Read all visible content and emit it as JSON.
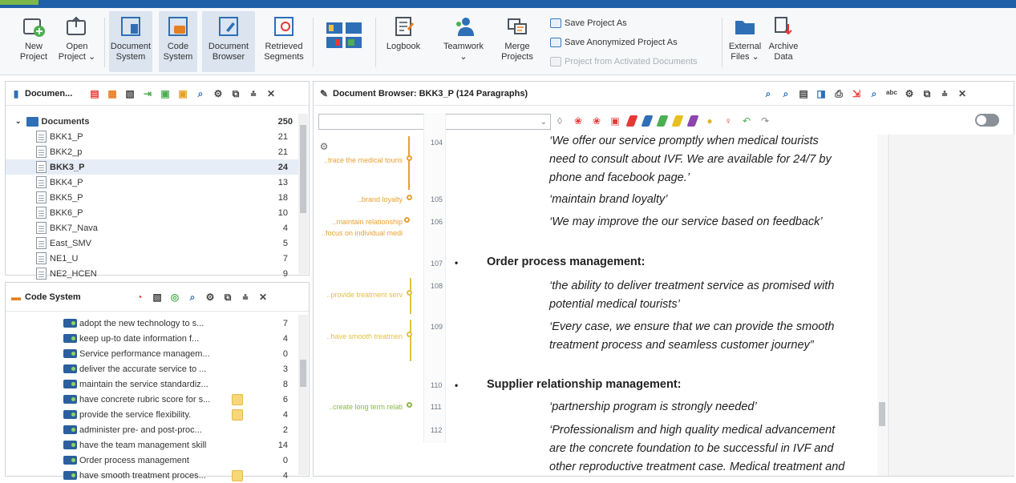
{
  "ribbon": {
    "buttons": [
      {
        "label": "New\nProject"
      },
      {
        "label": "Open\nProject ⌄"
      },
      {
        "label": "Document\nSystem"
      },
      {
        "label": "Code\nSystem"
      },
      {
        "label": "Document\nBrowser"
      },
      {
        "label": "Retrieved\nSegments"
      },
      {
        "label": "Logbook"
      },
      {
        "label": "Teamwork\n⌄"
      },
      {
        "label": "Merge\nProjects"
      },
      {
        "label": "External\nFiles ⌄"
      },
      {
        "label": "Archive\nData"
      }
    ],
    "small_actions": [
      {
        "label": "Save Project As"
      },
      {
        "label": "Save Anonymized Project As"
      },
      {
        "label": "Project from Activated Documents"
      }
    ]
  },
  "documents_panel": {
    "title": "Documen...",
    "root": {
      "label": "Documents",
      "count": "250"
    },
    "items": [
      {
        "label": "BKK1_P",
        "count": "21"
      },
      {
        "label": "BKK2_p",
        "count": "21"
      },
      {
        "label": "BKK3_P",
        "count": "24"
      },
      {
        "label": "BKK4_P",
        "count": "13"
      },
      {
        "label": "BKK5_P",
        "count": "18"
      },
      {
        "label": "BKK6_P",
        "count": "10"
      },
      {
        "label": "BKK7_Nava",
        "count": "4"
      },
      {
        "label": "East_SMV",
        "count": "5"
      },
      {
        "label": "NE1_U",
        "count": "7"
      },
      {
        "label": "NE2_HCEN",
        "count": "9"
      }
    ]
  },
  "code_panel": {
    "title": "Code System",
    "items": [
      {
        "label": "adopt the new technology to s...",
        "count": "7"
      },
      {
        "label": "keep up-to date information f...",
        "count": "4"
      },
      {
        "label": "Service performance managem...",
        "count": "0"
      },
      {
        "label": "deliver the accurate service to ...",
        "count": "3"
      },
      {
        "label": "maintain the service standardiz...",
        "count": "8"
      },
      {
        "label": "have concrete rubric score for s...",
        "count": "6"
      },
      {
        "label": "provide the service flexibility.",
        "count": "4"
      },
      {
        "label": "administer pre- and post-proc...",
        "count": "2"
      },
      {
        "label": "have the team management skill",
        "count": "14"
      },
      {
        "label": "Order process management",
        "count": "0"
      },
      {
        "label": "have smooth treatment proces...",
        "count": "4"
      }
    ]
  },
  "browser": {
    "title": "Document Browser: BKK3_P   (124 Paragraphs)",
    "segments": [
      {
        "label": "..trace the medical touris",
        "color": "#e8a030"
      },
      {
        "label": "..brand loyalty",
        "color": "#e8a030"
      },
      {
        "label": "..maintain relationship",
        "color": "#e8a030"
      },
      {
        "label": "..focus on individual medi",
        "color": "#e8a030"
      },
      {
        "label": "..provide treatment serv",
        "color": "#e2c040"
      },
      {
        "label": "..have smooth treatmen",
        "color": "#e2c040"
      },
      {
        "label": "..create long term relati",
        "color": "#8cb848"
      }
    ],
    "paragraph_numbers": [
      "104",
      "105",
      "106",
      "107",
      "108",
      "109",
      "110",
      "111",
      "112"
    ],
    "lines": [
      "‘We offer our service promptly when medical tourists",
      "need to consult about IVF. We are available for 24/7 by",
      "phone and facebook page.’",
      "‘maintain brand loyalty’",
      "‘We may improve the our service based on feedback’",
      "Order process management:",
      "‘the ability to deliver treatment service as promised with",
      "potential medical tourists’",
      "‘Every case, we ensure that we can provide the smooth",
      "treatment process and seamless customer journey”",
      "Supplier relationship management:",
      "‘partnership program is strongly needed’",
      "‘Professionalism and high quality medical advancement",
      "are the concrete foundation to be successful in IVF and",
      "other reproductive treatment case. Medical treatment and"
    ]
  }
}
